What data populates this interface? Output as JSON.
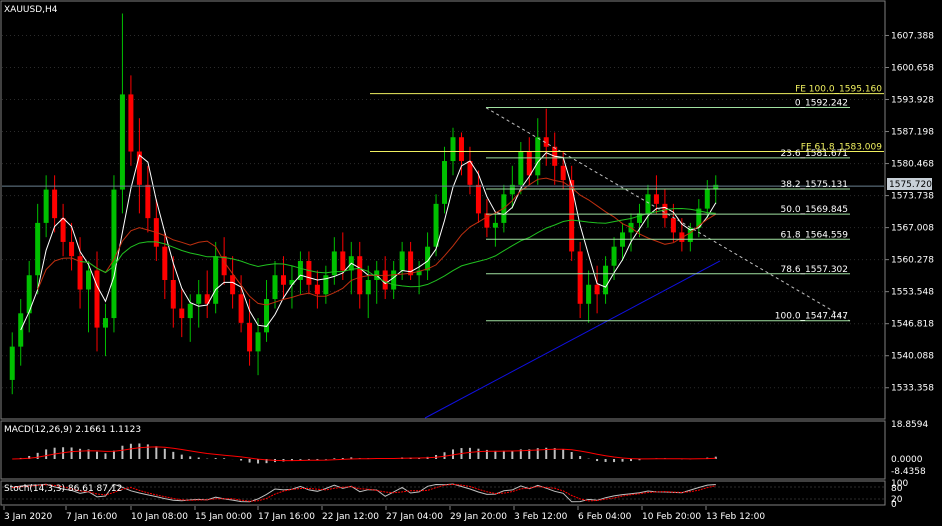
{
  "symbol_title": "XAUUSD,H4",
  "colors": {
    "bg": "#000000",
    "grid": "#2b2b2b",
    "frame": "#7f7f7f",
    "text": "#ffffff",
    "bull": "#00c000",
    "bear": "#ff0000",
    "fib": "#f0f060",
    "fibo_ret": "#a0e0a0",
    "ma_fast": "#ffffff",
    "ma_mid": "#c03010",
    "ma_slow": "#20c020",
    "ma_long": "#1010e0",
    "trend": "#c0c0c0",
    "price_line": "#6a7f8f",
    "macd_hist": "#c0c0c0",
    "macd_signal": "#ff0000",
    "stoch_main": "#c0c0c0",
    "stoch_signal": "#ff0000"
  },
  "price_axis": [
    "1607.388",
    "1600.658",
    "1593.928",
    "1587.198",
    "1580.468",
    "1573.738",
    "1567.008",
    "1560.278",
    "1553.548",
    "1546.818",
    "1540.088",
    "1533.358"
  ],
  "current_price": "1575.720",
  "fib_retracement": [
    {
      "label": "0_1592.242",
      "price": 1592.242
    },
    {
      "label": "23.6_1581.671",
      "price": 1581.671
    },
    {
      "label": "38.2_1575.131",
      "price": 1575.131
    },
    {
      "label": "50.0_1569.845",
      "price": 1569.845
    },
    {
      "label": "61.8_1564.559",
      "price": 1564.559
    },
    {
      "label": "78.6_1557.302",
      "price": 1557.302
    },
    {
      "label": "100.0_1547.447",
      "price": 1547.447
    }
  ],
  "fib_expansion": [
    {
      "label": "FE 100.0_1595.160",
      "price": 1595.16
    },
    {
      "label": "FE 61.8_1583.009",
      "price": 1583.009
    }
  ],
  "macd": {
    "label": "MACD(12,26,9) 2.1661 1.1123",
    "axis": [
      "18.8594",
      "0.0000",
      "-8.4358"
    ]
  },
  "stoch": {
    "label": "Stoch(14,3,3) 86.61 87.12",
    "axis": [
      "100",
      "80",
      "20",
      "0"
    ]
  },
  "time_axis": [
    "3 Jan 2020",
    "7 Jan 16:00",
    "10 Jan 08:00",
    "15 Jan 00:00",
    "17 Jan 16:00",
    "22 Jan 12:00",
    "27 Jan 04:00",
    "29 Jan 20:00",
    "3 Feb 12:00",
    "6 Feb 04:00",
    "10 Feb 20:00",
    "13 Feb 12:00"
  ],
  "chart_data": {
    "type": "candlestick",
    "title": "XAUUSD,H4",
    "ylim": [
      1527,
      1614
    ],
    "candles": [
      [
        1535,
        1545,
        1532,
        1542
      ],
      [
        1542,
        1552,
        1538,
        1549
      ],
      [
        1549,
        1560,
        1545,
        1557
      ],
      [
        1557,
        1572,
        1553,
        1568
      ],
      [
        1568,
        1578,
        1565,
        1575
      ],
      [
        1575,
        1578,
        1566,
        1569
      ],
      [
        1569,
        1572,
        1561,
        1564
      ],
      [
        1564,
        1568,
        1558,
        1561
      ],
      [
        1561,
        1565,
        1550,
        1554
      ],
      [
        1554,
        1560,
        1545,
        1558
      ],
      [
        1558,
        1562,
        1541,
        1546
      ],
      [
        1546,
        1551,
        1540,
        1548
      ],
      [
        1548,
        1578,
        1545,
        1575
      ],
      [
        1575,
        1612,
        1570,
        1595
      ],
      [
        1595,
        1599,
        1580,
        1583
      ],
      [
        1583,
        1590,
        1570,
        1576
      ],
      [
        1576,
        1580,
        1566,
        1569
      ],
      [
        1569,
        1573,
        1560,
        1563
      ],
      [
        1563,
        1566,
        1552,
        1556
      ],
      [
        1556,
        1561,
        1546,
        1550
      ],
      [
        1550,
        1554,
        1544,
        1548
      ],
      [
        1548,
        1553,
        1543,
        1551
      ],
      [
        1551,
        1556,
        1546,
        1553
      ],
      [
        1553,
        1558,
        1548,
        1551
      ],
      [
        1551,
        1564,
        1549,
        1561
      ],
      [
        1561,
        1565,
        1555,
        1557
      ],
      [
        1557,
        1561,
        1550,
        1553
      ],
      [
        1553,
        1557,
        1545,
        1547
      ],
      [
        1547,
        1552,
        1538,
        1541
      ],
      [
        1541,
        1548,
        1536,
        1545
      ],
      [
        1545,
        1556,
        1543,
        1552
      ],
      [
        1552,
        1560,
        1550,
        1557
      ],
      [
        1557,
        1561,
        1552,
        1555
      ],
      [
        1555,
        1559,
        1550,
        1556
      ],
      [
        1556,
        1562,
        1553,
        1560
      ],
      [
        1560,
        1562,
        1553,
        1555
      ],
      [
        1555,
        1558,
        1550,
        1553
      ],
      [
        1553,
        1559,
        1551,
        1557
      ],
      [
        1557,
        1565,
        1555,
        1562
      ],
      [
        1562,
        1566,
        1556,
        1558
      ],
      [
        1558,
        1564,
        1553,
        1561
      ],
      [
        1561,
        1564,
        1550,
        1553
      ],
      [
        1553,
        1559,
        1548,
        1556
      ],
      [
        1556,
        1560,
        1551,
        1558
      ],
      [
        1558,
        1561,
        1552,
        1554
      ],
      [
        1554,
        1560,
        1552,
        1558
      ],
      [
        1558,
        1564,
        1556,
        1562
      ],
      [
        1562,
        1564,
        1556,
        1557
      ],
      [
        1557,
        1560,
        1553,
        1558
      ],
      [
        1558,
        1566,
        1556,
        1563
      ],
      [
        1563,
        1574,
        1561,
        1572
      ],
      [
        1572,
        1584,
        1570,
        1581
      ],
      [
        1581,
        1588,
        1578,
        1586
      ],
      [
        1586,
        1587,
        1578,
        1581
      ],
      [
        1581,
        1584,
        1574,
        1576
      ],
      [
        1576,
        1579,
        1568,
        1570
      ],
      [
        1570,
        1573,
        1565,
        1567
      ],
      [
        1567,
        1570,
        1563,
        1568
      ],
      [
        1568,
        1576,
        1566,
        1574
      ],
      [
        1574,
        1580,
        1571,
        1576
      ],
      [
        1576,
        1585,
        1574,
        1583
      ],
      [
        1583,
        1586,
        1576,
        1578
      ],
      [
        1578,
        1590,
        1576,
        1586
      ],
      [
        1586,
        1592,
        1580,
        1584
      ],
      [
        1584,
        1587,
        1576,
        1580
      ],
      [
        1580,
        1583,
        1575,
        1577
      ],
      [
        1577,
        1580,
        1560,
        1562
      ],
      [
        1562,
        1564,
        1548,
        1551
      ],
      [
        1551,
        1558,
        1547,
        1555
      ],
      [
        1555,
        1559,
        1549,
        1553
      ],
      [
        1553,
        1561,
        1551,
        1559
      ],
      [
        1559,
        1565,
        1556,
        1563
      ],
      [
        1563,
        1568,
        1560,
        1566
      ],
      [
        1566,
        1570,
        1562,
        1568
      ],
      [
        1568,
        1572,
        1565,
        1570
      ],
      [
        1570,
        1576,
        1567,
        1574
      ],
      [
        1574,
        1578,
        1570,
        1572
      ],
      [
        1572,
        1575,
        1567,
        1569
      ],
      [
        1569,
        1572,
        1564,
        1566
      ],
      [
        1566,
        1569,
        1562,
        1564
      ],
      [
        1564,
        1568,
        1562,
        1567
      ],
      [
        1567,
        1573,
        1565,
        1571
      ],
      [
        1571,
        1577,
        1569,
        1575
      ],
      [
        1575,
        1578,
        1572,
        1576
      ]
    ]
  }
}
